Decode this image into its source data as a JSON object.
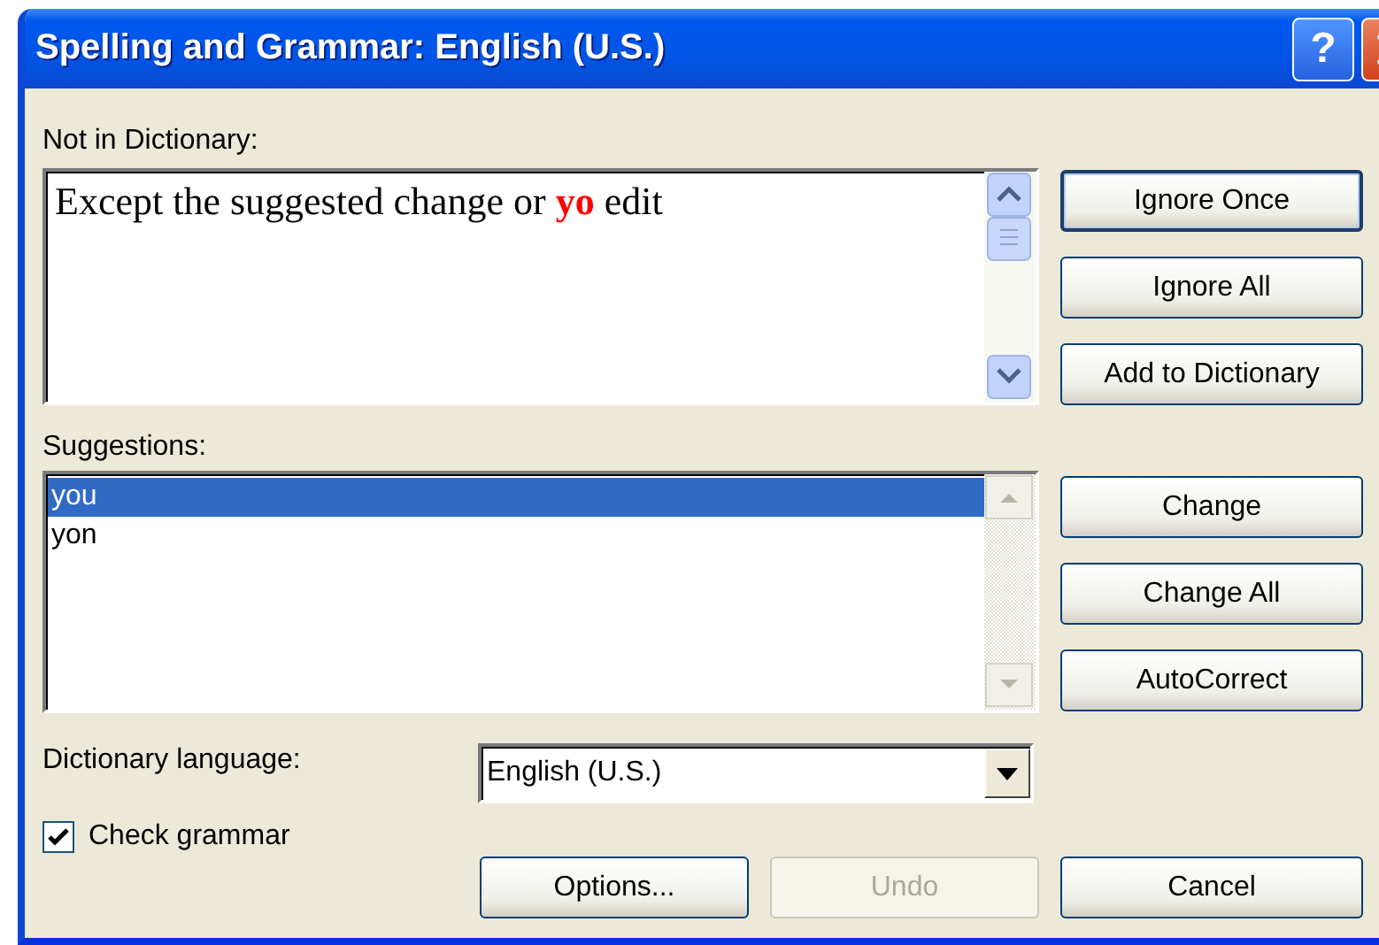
{
  "window": {
    "title": "Spelling and Grammar: English (U.S.)",
    "help_button": "?"
  },
  "not_in_dictionary": {
    "label": "Not in Dictionary:",
    "sentence": "Except the suggested change or **yo** edit"
  },
  "side_buttons": [
    {
      "label": "Ignore Once",
      "default": true
    },
    {
      "label": "Ignore All",
      "default": false
    },
    {
      "label": "Add to Dictionary",
      "default": false
    }
  ],
  "suggestions": {
    "label": "Suggestions:",
    "items": [
      {
        "text": "you",
        "selected": true
      },
      {
        "text": "yon",
        "selected": false
      }
    ]
  },
  "change_buttons": [
    {
      "label": "Change",
      "default": false
    },
    {
      "label": "Change All",
      "default": false
    },
    {
      "label": "AutoCorrect",
      "default": false
    }
  ],
  "dictionary_language": {
    "label": "Dictionary language:",
    "value": "English (U.S.)"
  },
  "check_grammar": {
    "label": "Check grammar",
    "checked": true
  },
  "bottom_buttons": [
    {
      "label": "Options...",
      "disabled": false
    },
    {
      "label": "Undo",
      "disabled": true
    },
    {
      "label": "Cancel",
      "disabled": false
    }
  ]
}
